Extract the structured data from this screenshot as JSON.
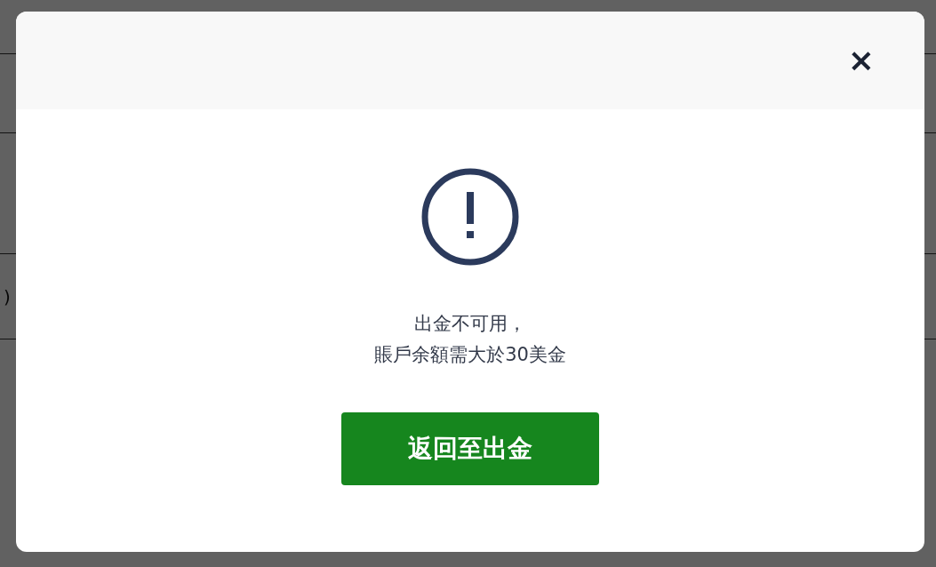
{
  "background": {
    "fragment": ")"
  },
  "dialog": {
    "close": "×",
    "message_lines": [
      "出金不可用，",
      "賬戶余額需大於30美金"
    ],
    "button": "返回至出金"
  }
}
